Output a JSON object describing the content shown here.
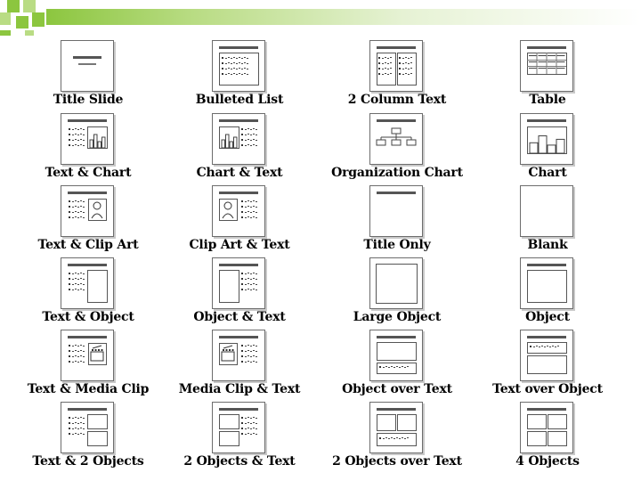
{
  "theme": {
    "accent": "#8cc63f",
    "accent_light": "#b9dc84"
  },
  "layouts": [
    {
      "label": "Title Slide",
      "icon": "title-slide-layout-icon",
      "kind": "title-slide"
    },
    {
      "label": "Bulleted List",
      "icon": "bulleted-list-layout-icon",
      "kind": "bullets"
    },
    {
      "label": "2 Column Text",
      "icon": "two-column-text-layout-icon",
      "kind": "two-col"
    },
    {
      "label": "Table",
      "icon": "table-layout-icon",
      "kind": "table"
    },
    {
      "label": "Text & Chart",
      "icon": "text-chart-layout-icon",
      "kind": "text-chart"
    },
    {
      "label": "Chart & Text",
      "icon": "chart-text-layout-icon",
      "kind": "chart-text"
    },
    {
      "label": "Organization Chart",
      "icon": "organization-chart-layout-icon",
      "kind": "org"
    },
    {
      "label": "Chart",
      "icon": "chart-layout-icon",
      "kind": "chart"
    },
    {
      "label": "Text & Clip Art",
      "icon": "text-clip-art-layout-icon",
      "kind": "text-clip"
    },
    {
      "label": "Clip Art & Text",
      "icon": "clip-art-text-layout-icon",
      "kind": "clip-text"
    },
    {
      "label": "Title Only",
      "icon": "title-only-layout-icon",
      "kind": "title-only"
    },
    {
      "label": "Blank",
      "icon": "blank-layout-icon",
      "kind": "blank"
    },
    {
      "label": "Text & Object",
      "icon": "text-object-layout-icon",
      "kind": "text-obj"
    },
    {
      "label": "Object & Text",
      "icon": "object-text-layout-icon",
      "kind": "obj-text"
    },
    {
      "label": "Large Object",
      "icon": "large-object-layout-icon",
      "kind": "large-obj"
    },
    {
      "label": "Object",
      "icon": "object-layout-icon",
      "kind": "obj"
    },
    {
      "label": "Text & Media Clip",
      "icon": "text-media-clip-layout-icon",
      "kind": "text-media"
    },
    {
      "label": "Media Clip & Text",
      "icon": "media-clip-text-layout-icon",
      "kind": "media-text"
    },
    {
      "label": "Object over Text",
      "icon": "object-over-text-layout-icon",
      "kind": "obj-over-text"
    },
    {
      "label": "Text over Object",
      "icon": "text-over-object-layout-icon",
      "kind": "text-over-obj"
    },
    {
      "label": "Text & 2 Objects",
      "icon": "text-two-objects-layout-icon",
      "kind": "text-2obj"
    },
    {
      "label": "2 Objects & Text",
      "icon": "two-objects-text-layout-icon",
      "kind": "2obj-text"
    },
    {
      "label": "2 Objects over Text",
      "icon": "two-objects-over-text-layout-icon",
      "kind": "2obj-over-text"
    },
    {
      "label": "4 Objects",
      "icon": "four-objects-layout-icon",
      "kind": "4obj"
    }
  ]
}
